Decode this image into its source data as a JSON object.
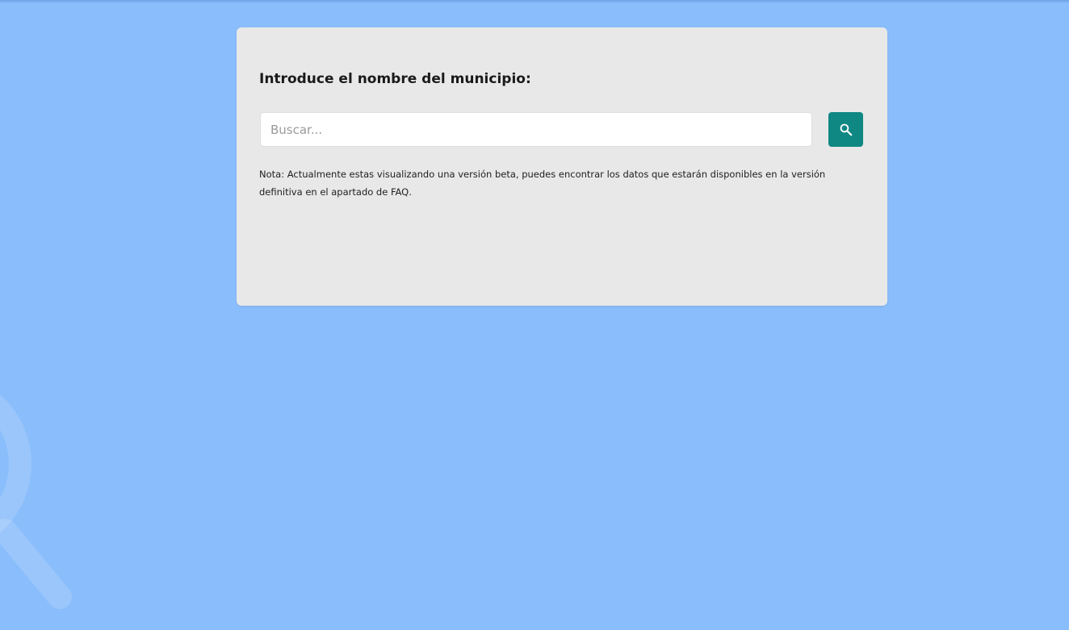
{
  "colors": {
    "page_background": "#8abdfb",
    "card_background": "#e8e8e8",
    "accent": "#0f8783"
  },
  "search_card": {
    "title": "Introduce el nombre del municipio:",
    "input": {
      "value": "",
      "placeholder": "Buscar..."
    },
    "button_icon": "search-icon",
    "note": "Nota: Actualmente estas visualizando una versión beta, puedes encontrar los datos que estarán disponibles en la versión definitiva en el apartado de FAQ."
  },
  "background_decoration": "magnifier-watermark-icon"
}
